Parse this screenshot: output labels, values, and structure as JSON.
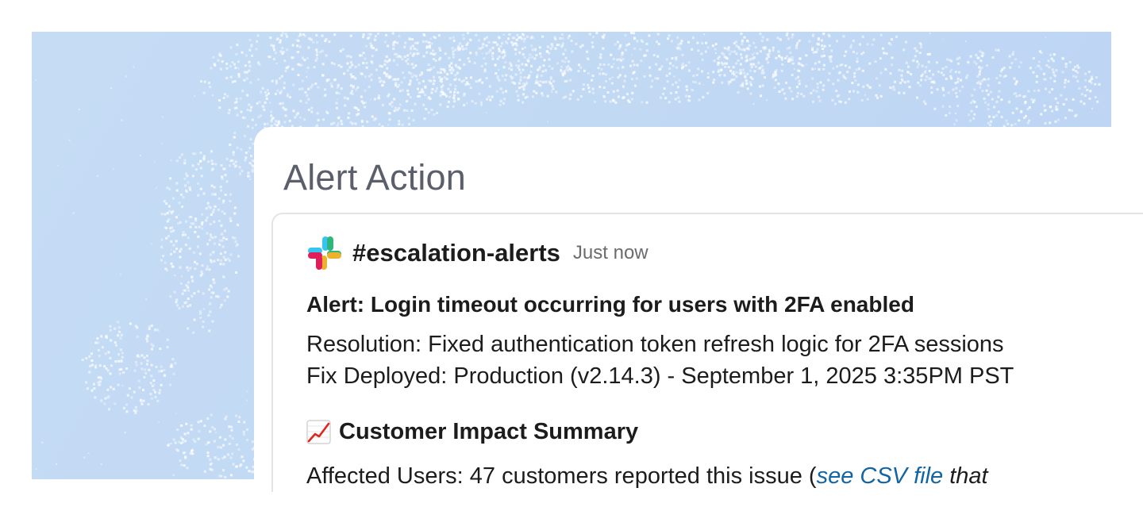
{
  "panel": {
    "title": "Alert Action"
  },
  "message": {
    "channel": "#escalation-alerts",
    "timestamp": "Just now",
    "logo_icon": "slack-logo-icon",
    "alert_title": "Alert: Login timeout occurring for users with 2FA enabled",
    "resolution": "Resolution: Fixed authentication token refresh logic for 2FA sessions",
    "deployed": "Fix Deployed: Production (v2.14.3) - September 1, 2025 3:35PM PST",
    "summary_icon": "chart-increasing-icon",
    "summary_heading": "Customer Impact Summary",
    "affected_prefix": "Affected Users: 47 customers reported this issue (",
    "affected_link": "see CSV file",
    "affected_suffix": " that"
  },
  "colors": {
    "backdrop": "#c2d9f4",
    "text": "#1d1c1d",
    "title": "#5b5f6c",
    "link": "#1264a3"
  }
}
